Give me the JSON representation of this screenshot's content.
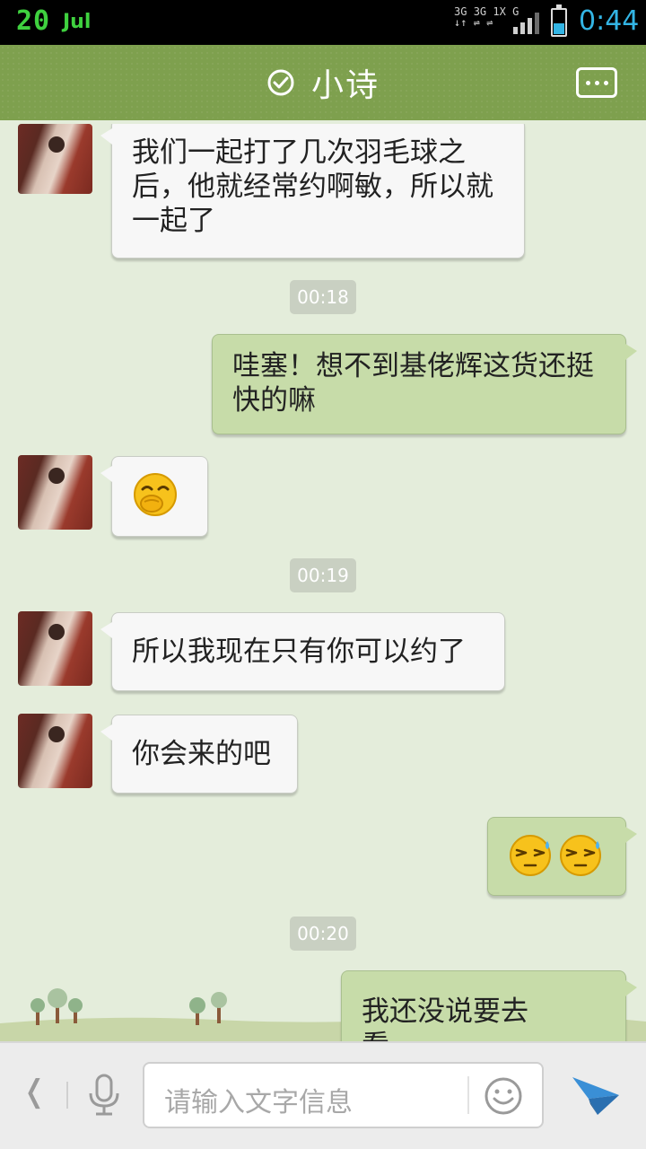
{
  "status_bar": {
    "date_day": "20",
    "date_month": "Jul",
    "network_labels": [
      "3G",
      "3G",
      "1X",
      "G"
    ],
    "time": "0:44",
    "accent_color": "#33b5e5"
  },
  "header": {
    "title": "小诗",
    "status_icon": "check-circle-icon",
    "menu_icon": "more-dots-icon",
    "color": "#7ea04e"
  },
  "messages": [
    {
      "side": "left",
      "type": "text",
      "text": "我们一起打了几次羽毛球之后，他就经常约啊敏，所以就一起了"
    },
    {
      "side": "time",
      "text": "00:18"
    },
    {
      "side": "right",
      "type": "text",
      "text": "哇塞！想不到基佬辉这货还挺快的嘛"
    },
    {
      "side": "left",
      "type": "emoji",
      "emoji": [
        "covering-mouth-laugh-emoji"
      ]
    },
    {
      "side": "time",
      "text": "00:19"
    },
    {
      "side": "left",
      "type": "text",
      "text": "所以我现在只有你可以约了"
    },
    {
      "side": "left",
      "type": "text",
      "text": "你会来的吧"
    },
    {
      "side": "right",
      "type": "emoji",
      "emoji": [
        "sweat-emoji",
        "sweat-emoji"
      ]
    },
    {
      "side": "time",
      "text": "00:20"
    },
    {
      "side": "right",
      "type": "text",
      "text": "我还没说要去看……"
    }
  ],
  "input_bar": {
    "back_icon": "chevron-left-icon",
    "voice_icon": "microphone-icon",
    "placeholder": "请输入文字信息",
    "emoji_icon": "smiley-icon",
    "send_icon": "paper-plane-icon"
  }
}
